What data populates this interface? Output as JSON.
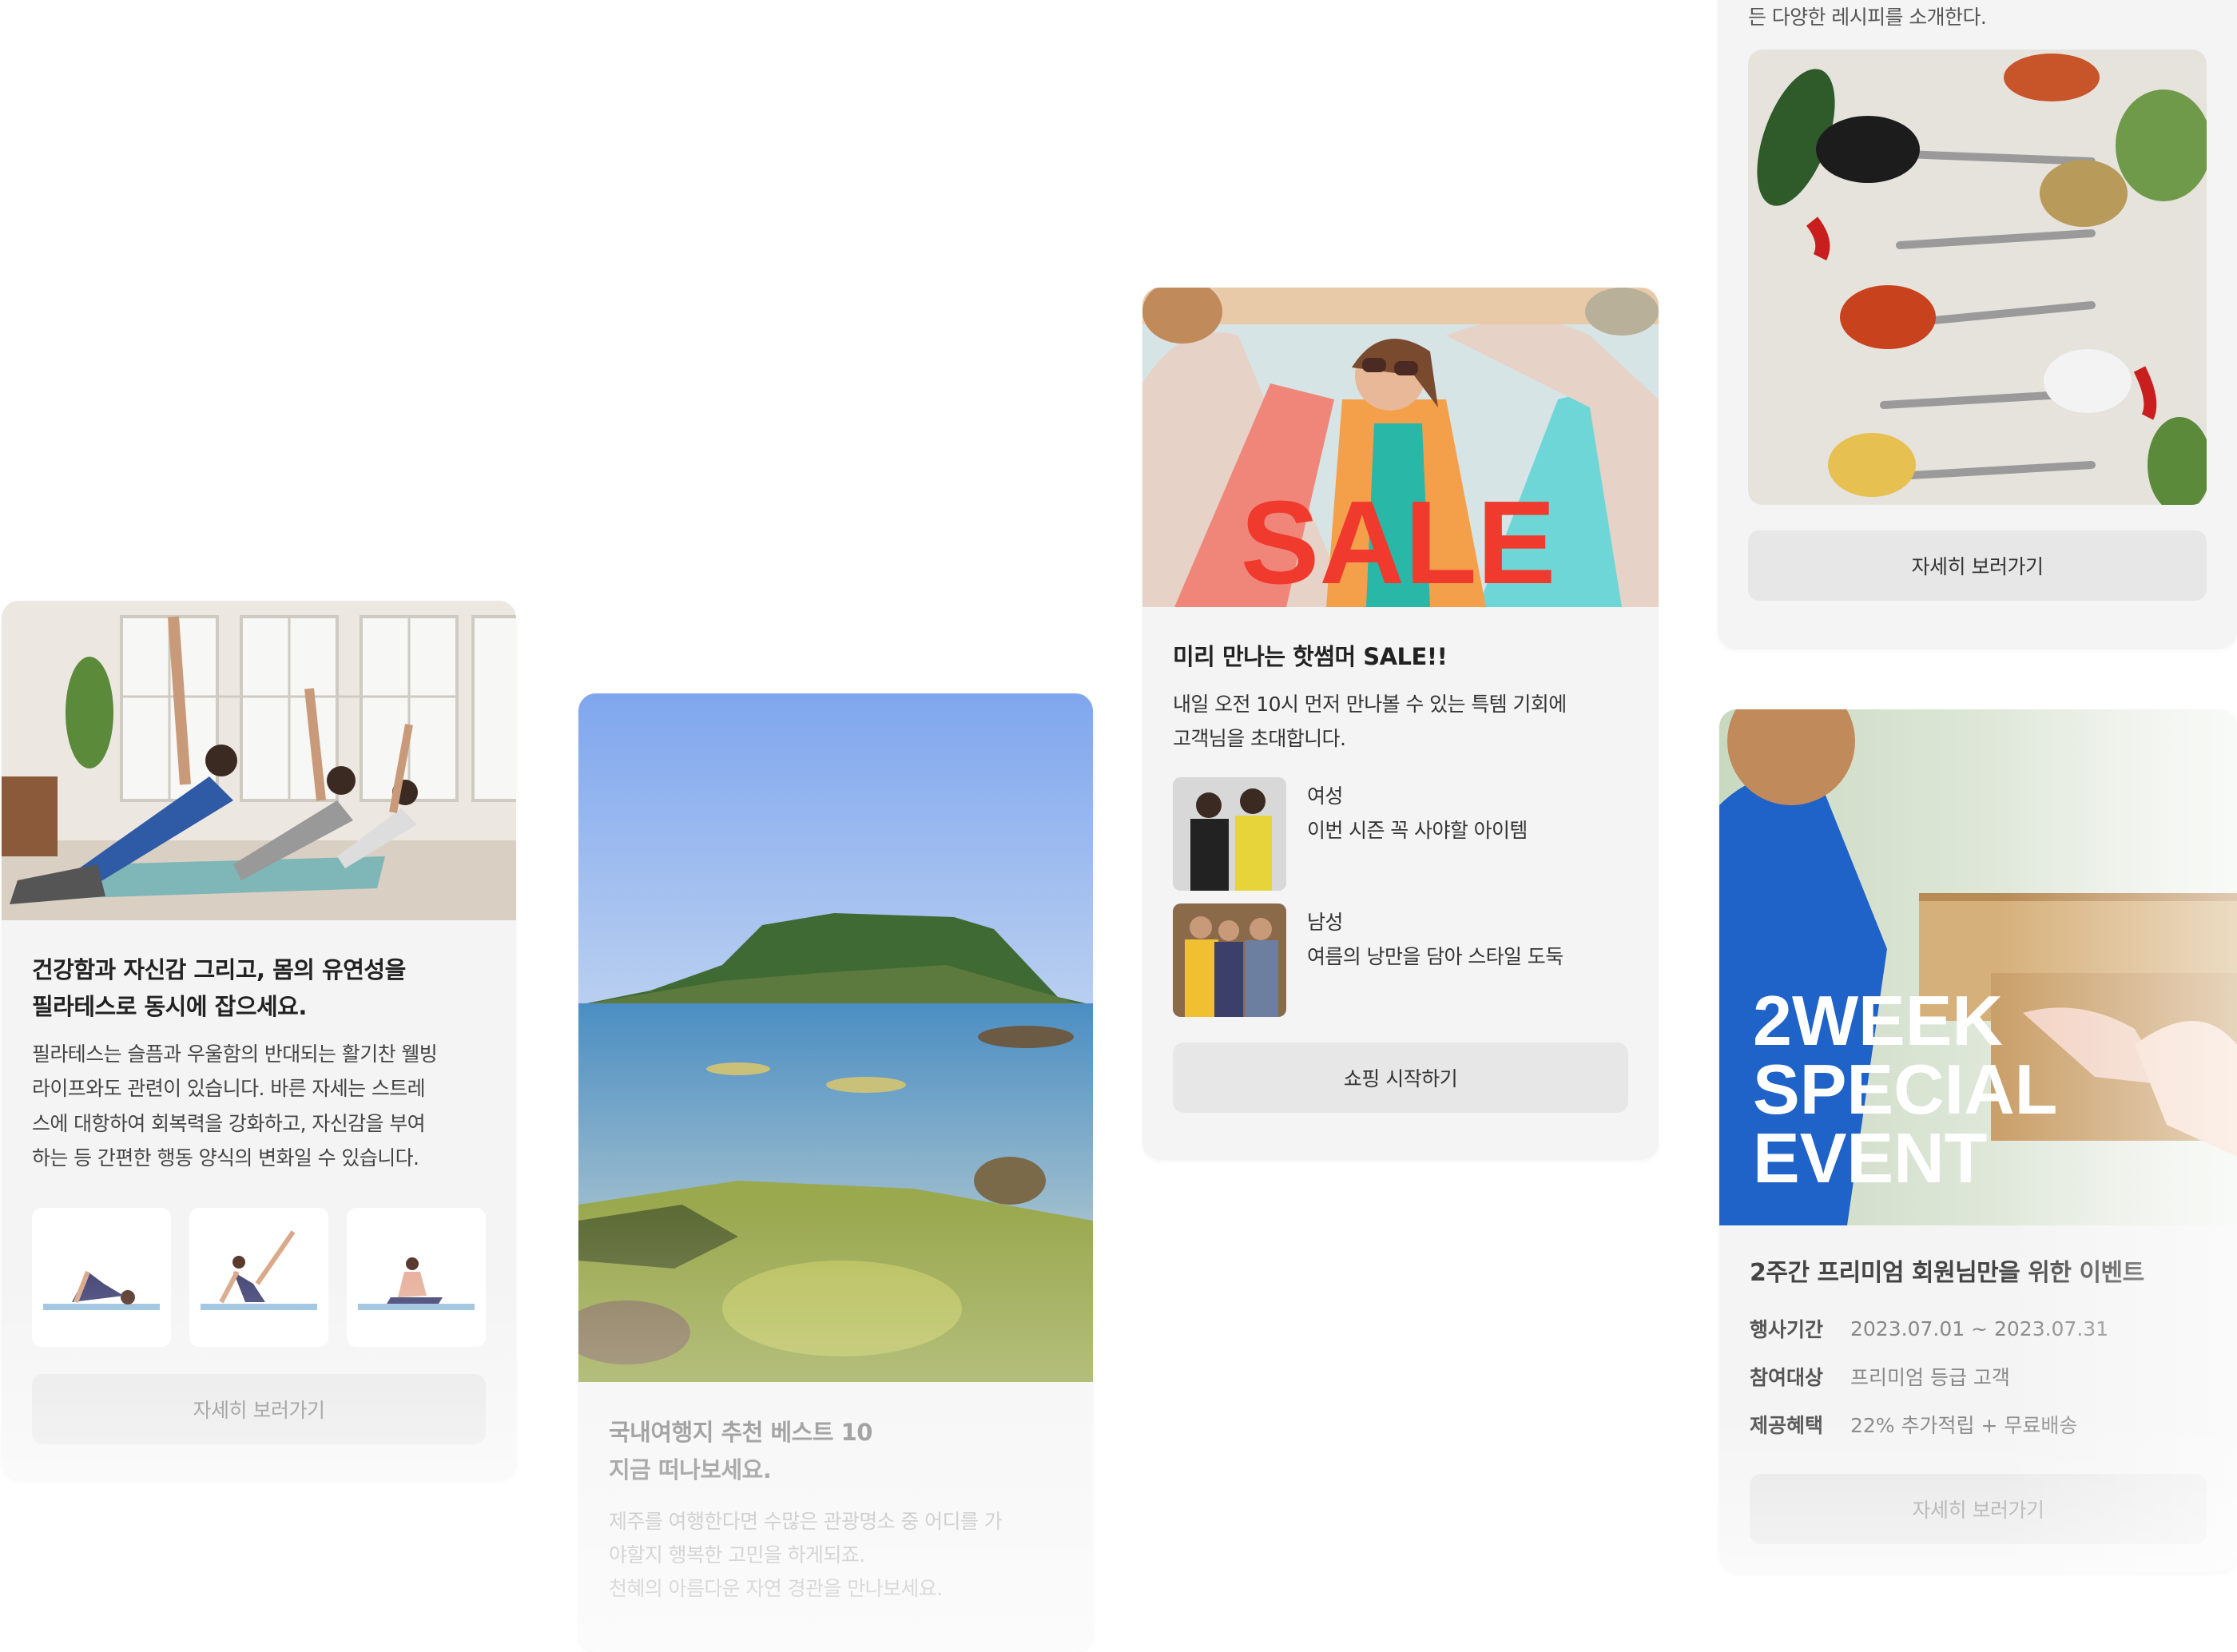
{
  "cards": {
    "pilates": {
      "title_line1": "건강함과 자신감 그리고, 몸의 유연성을",
      "title_line2": "필라테스로 동시에 잡으세요.",
      "desc_line1": "필라테스는 슬픔과 우울함의 반대되는 활기찬 웰빙",
      "desc_line2": "라이프와도 관련이 있습니다. 바른 자세는 스트레",
      "desc_line3": "스에 대항하여 회복력을 강화하고, 자신감을 부여",
      "desc_line4": "하는 등 간편한 행동 양식의 변화일 수 있습니다.",
      "button": "자세히 보러가기"
    },
    "travel": {
      "title_line1": "국내여행지 추천 베스트 10",
      "title_line2": "지금 떠나보세요.",
      "desc_line1": "제주를 여행한다면 수많은 관광명소 중 어디를 가",
      "desc_line2": "야할지 행복한 고민을 하게되죠.",
      "desc_line3": "천혜의 아름다운 자연 경관을 만나보세요."
    },
    "sale": {
      "image_text": "SALE",
      "title": "미리 만나는 핫썸머 SALE!!",
      "desc_line1": "내일 오전 10시 먼저 만나볼 수 있는 특템 기회에",
      "desc_line2": "고객님을 초대합니다.",
      "items": [
        {
          "label": "여성",
          "sub": "이번 시즌 꼭 사야할 아이템"
        },
        {
          "label": "남성",
          "sub": "여름의 낭만을 담아 스타일 도둑"
        }
      ],
      "button": "쇼핑 시작하기"
    },
    "recipe": {
      "desc_top": "든 다양한 레시피를 소개한다.",
      "button": "자세히 보러가기"
    },
    "event": {
      "image_line1": "2WEEK",
      "image_line2": "SPECIAL",
      "image_line3": "EVENT",
      "title": "2주간 프리미엄 회원님만을 위한 이벤트",
      "rows": [
        {
          "label": "행사기간",
          "value": "2023.07.01 ~ 2023.07.31"
        },
        {
          "label": "참여대상",
          "value": "프리미엄 등급 고객"
        },
        {
          "label": "제공혜택",
          "value": "22% 추가적립 + 무료배송"
        }
      ],
      "button": "자세히 보러가기"
    }
  },
  "colors": {
    "card_bg": "#f4f4f4",
    "button_bg": "#e7e7e7",
    "sale_red": "#f03a2e"
  }
}
